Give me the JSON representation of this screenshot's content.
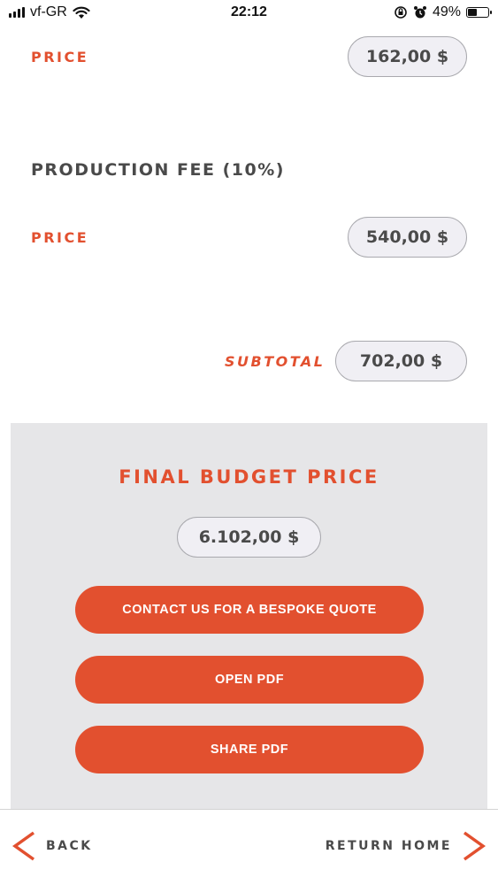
{
  "status_bar": {
    "carrier": "vf-GR",
    "time": "22:12",
    "battery_percent": "49%",
    "battery_level": 0.49
  },
  "sections": {
    "first_price": {
      "label": "PRICE",
      "value": "162,00 $"
    },
    "production_fee": {
      "title": "PRODUCTION FEE (10%)",
      "price_label": "PRICE",
      "price_value": "540,00 $"
    },
    "subtotal": {
      "label": "SUBTOTAL",
      "value": "702,00 $"
    }
  },
  "final": {
    "title": "FINAL BUDGET PRICE",
    "value": "6.102,00 $",
    "buttons": {
      "contact": "CONTACT US FOR A BESPOKE QUOTE",
      "open_pdf": "OPEN PDF",
      "share_pdf": "SHARE PDF"
    }
  },
  "nav": {
    "back": "BACK",
    "return_home": "RETURN HOME"
  },
  "colors": {
    "accent": "#e2502f",
    "text": "#4a4a4a",
    "panel": "#e6e6e8",
    "pill_bg": "#f0eff4",
    "pill_border": "#a9a9ae"
  },
  "icons": {
    "signal": "cellular-signal-icon",
    "wifi": "wifi-icon",
    "orientation_lock": "orientation-lock-icon",
    "alarm": "alarm-clock-icon",
    "battery": "battery-icon",
    "back": "chevron-left-icon",
    "forward": "chevron-right-icon"
  }
}
